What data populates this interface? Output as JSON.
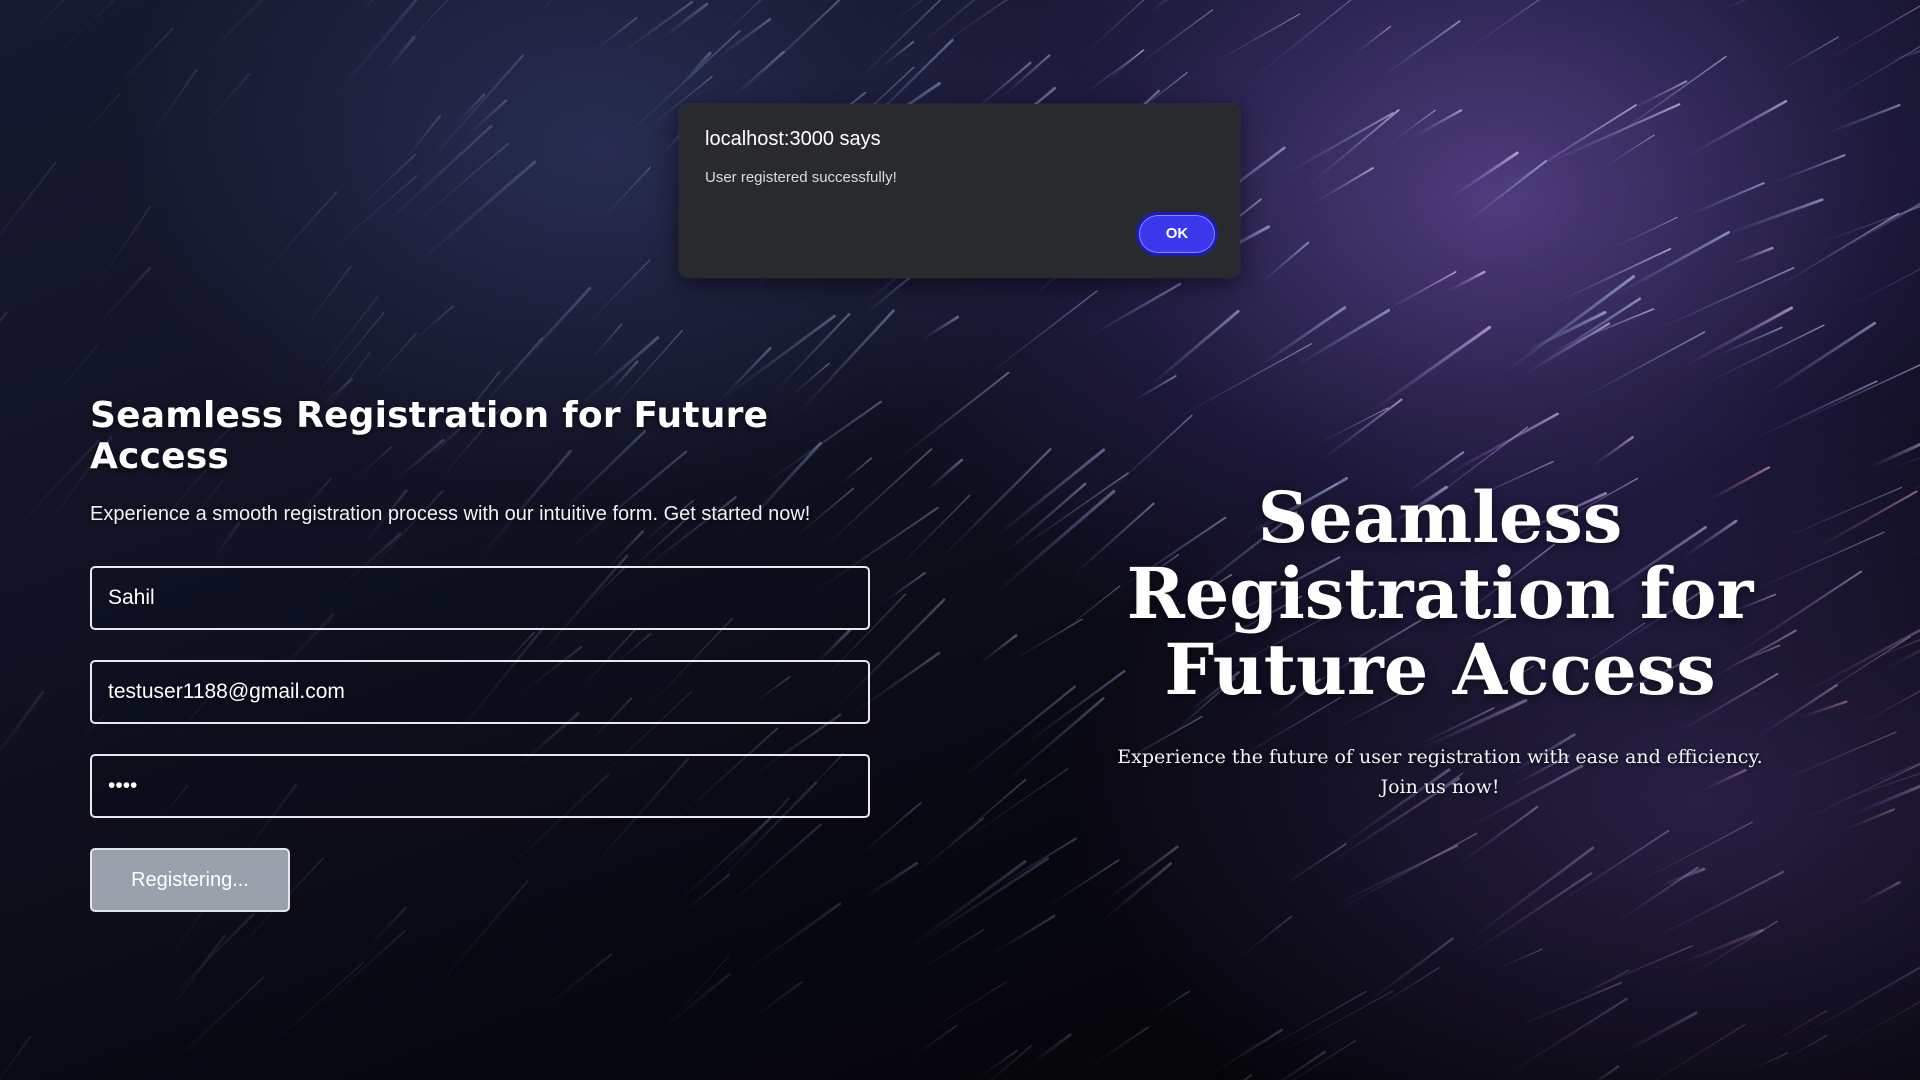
{
  "dialog": {
    "origin": "localhost:3000 says",
    "message": "User registered successfully!",
    "ok_label": "OK"
  },
  "form": {
    "title": "Seamless Registration for Future Access",
    "subtitle": "Experience a smooth registration process with our intuitive form. Get started now!",
    "name_value": "Sahil",
    "email_value": "testuser1188@gmail.com",
    "password_value": "••••",
    "submit_label": "Registering..."
  },
  "hero": {
    "title": "Seamless Registration for Future Access",
    "subtitle": "Experience the future of user registration with ease and efficiency. Join us now!"
  },
  "colors": {
    "ok_button": "#3b37ec",
    "dialog_bg": "#292a2d",
    "submit_button_disabled": "#9aa0ac"
  }
}
